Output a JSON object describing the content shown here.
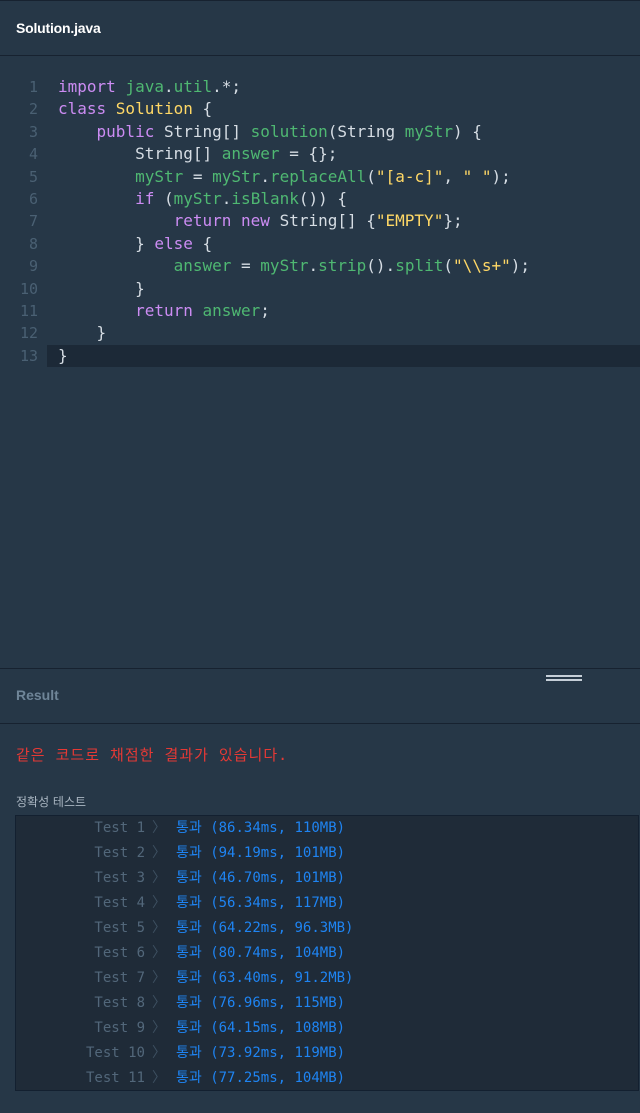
{
  "tab": {
    "title": "Solution.java"
  },
  "editor": {
    "lines": [
      {
        "num": "1",
        "segments": [
          {
            "t": "import ",
            "c": "kw"
          },
          {
            "t": "java",
            "c": "id"
          },
          {
            "t": ".",
            "c": "pl"
          },
          {
            "t": "util",
            "c": "id"
          },
          {
            "t": ".*;",
            "c": "pl"
          }
        ]
      },
      {
        "num": "2",
        "segments": [
          {
            "t": "class ",
            "c": "kw"
          },
          {
            "t": "Solution",
            "c": "cls"
          },
          {
            "t": " {",
            "c": "pl"
          }
        ]
      },
      {
        "num": "3",
        "segments": [
          {
            "t": "    ",
            "c": "pl"
          },
          {
            "t": "public ",
            "c": "kw"
          },
          {
            "t": "String[] ",
            "c": "pl"
          },
          {
            "t": "solution",
            "c": "id"
          },
          {
            "t": "(String ",
            "c": "pl"
          },
          {
            "t": "myStr",
            "c": "id"
          },
          {
            "t": ") {",
            "c": "pl"
          }
        ]
      },
      {
        "num": "4",
        "segments": [
          {
            "t": "        String[] ",
            "c": "pl"
          },
          {
            "t": "answer",
            "c": "id"
          },
          {
            "t": " = {};",
            "c": "pl"
          }
        ]
      },
      {
        "num": "5",
        "segments": [
          {
            "t": "        ",
            "c": "pl"
          },
          {
            "t": "myStr",
            "c": "id"
          },
          {
            "t": " = ",
            "c": "pl"
          },
          {
            "t": "myStr",
            "c": "id"
          },
          {
            "t": ".",
            "c": "pl"
          },
          {
            "t": "replaceAll",
            "c": "id"
          },
          {
            "t": "(",
            "c": "pl"
          },
          {
            "t": "\"[a-c]\"",
            "c": "str"
          },
          {
            "t": ", ",
            "c": "pl"
          },
          {
            "t": "\" \"",
            "c": "str"
          },
          {
            "t": ");",
            "c": "pl"
          }
        ]
      },
      {
        "num": "6",
        "segments": [
          {
            "t": "        ",
            "c": "pl"
          },
          {
            "t": "if ",
            "c": "kw"
          },
          {
            "t": "(",
            "c": "pl"
          },
          {
            "t": "myStr",
            "c": "id"
          },
          {
            "t": ".",
            "c": "pl"
          },
          {
            "t": "isBlank",
            "c": "id"
          },
          {
            "t": "()) {",
            "c": "pl"
          }
        ]
      },
      {
        "num": "7",
        "segments": [
          {
            "t": "            ",
            "c": "pl"
          },
          {
            "t": "return ",
            "c": "kw"
          },
          {
            "t": "new ",
            "c": "kw"
          },
          {
            "t": "String[] {",
            "c": "pl"
          },
          {
            "t": "\"EMPTY\"",
            "c": "str"
          },
          {
            "t": "};",
            "c": "pl"
          }
        ]
      },
      {
        "num": "8",
        "segments": [
          {
            "t": "        } ",
            "c": "pl"
          },
          {
            "t": "else",
            "c": "kw"
          },
          {
            "t": " {",
            "c": "pl"
          }
        ]
      },
      {
        "num": "9",
        "segments": [
          {
            "t": "            ",
            "c": "pl"
          },
          {
            "t": "answer",
            "c": "id"
          },
          {
            "t": " = ",
            "c": "pl"
          },
          {
            "t": "myStr",
            "c": "id"
          },
          {
            "t": ".",
            "c": "pl"
          },
          {
            "t": "strip",
            "c": "id"
          },
          {
            "t": "().",
            "c": "pl"
          },
          {
            "t": "split",
            "c": "id"
          },
          {
            "t": "(",
            "c": "pl"
          },
          {
            "t": "\"\\\\s+\"",
            "c": "str"
          },
          {
            "t": ");",
            "c": "pl"
          }
        ]
      },
      {
        "num": "10",
        "segments": [
          {
            "t": "        }",
            "c": "pl"
          }
        ]
      },
      {
        "num": "11",
        "segments": [
          {
            "t": "        ",
            "c": "pl"
          },
          {
            "t": "return ",
            "c": "kw"
          },
          {
            "t": "answer",
            "c": "id"
          },
          {
            "t": ";",
            "c": "pl"
          }
        ]
      },
      {
        "num": "12",
        "segments": [
          {
            "t": "    }",
            "c": "pl"
          }
        ]
      },
      {
        "num": "13",
        "segments": [
          {
            "t": "}",
            "c": "pl"
          }
        ],
        "active": true
      }
    ]
  },
  "result": {
    "title": "Result",
    "message": "같은 코드로 채점한 결과가 있습니다.",
    "section_label": "정확성  테스트",
    "chevron": "〉",
    "tests": [
      {
        "name": "Test 1",
        "result": "통과 (86.34ms, 110MB)"
      },
      {
        "name": "Test 2",
        "result": "통과 (94.19ms, 101MB)"
      },
      {
        "name": "Test 3",
        "result": "통과 (46.70ms, 101MB)"
      },
      {
        "name": "Test 4",
        "result": "통과 (56.34ms, 117MB)"
      },
      {
        "name": "Test 5",
        "result": "통과 (64.22ms, 96.3MB)"
      },
      {
        "name": "Test 6",
        "result": "통과 (80.74ms, 104MB)"
      },
      {
        "name": "Test 7",
        "result": "통과 (63.40ms, 91.2MB)"
      },
      {
        "name": "Test 8",
        "result": "통과 (76.96ms, 115MB)"
      },
      {
        "name": "Test 9",
        "result": "통과 (64.15ms, 108MB)"
      },
      {
        "name": "Test 10",
        "result": "통과 (73.92ms, 119MB)"
      },
      {
        "name": "Test 11",
        "result": "통과 (77.25ms, 104MB)"
      }
    ]
  }
}
